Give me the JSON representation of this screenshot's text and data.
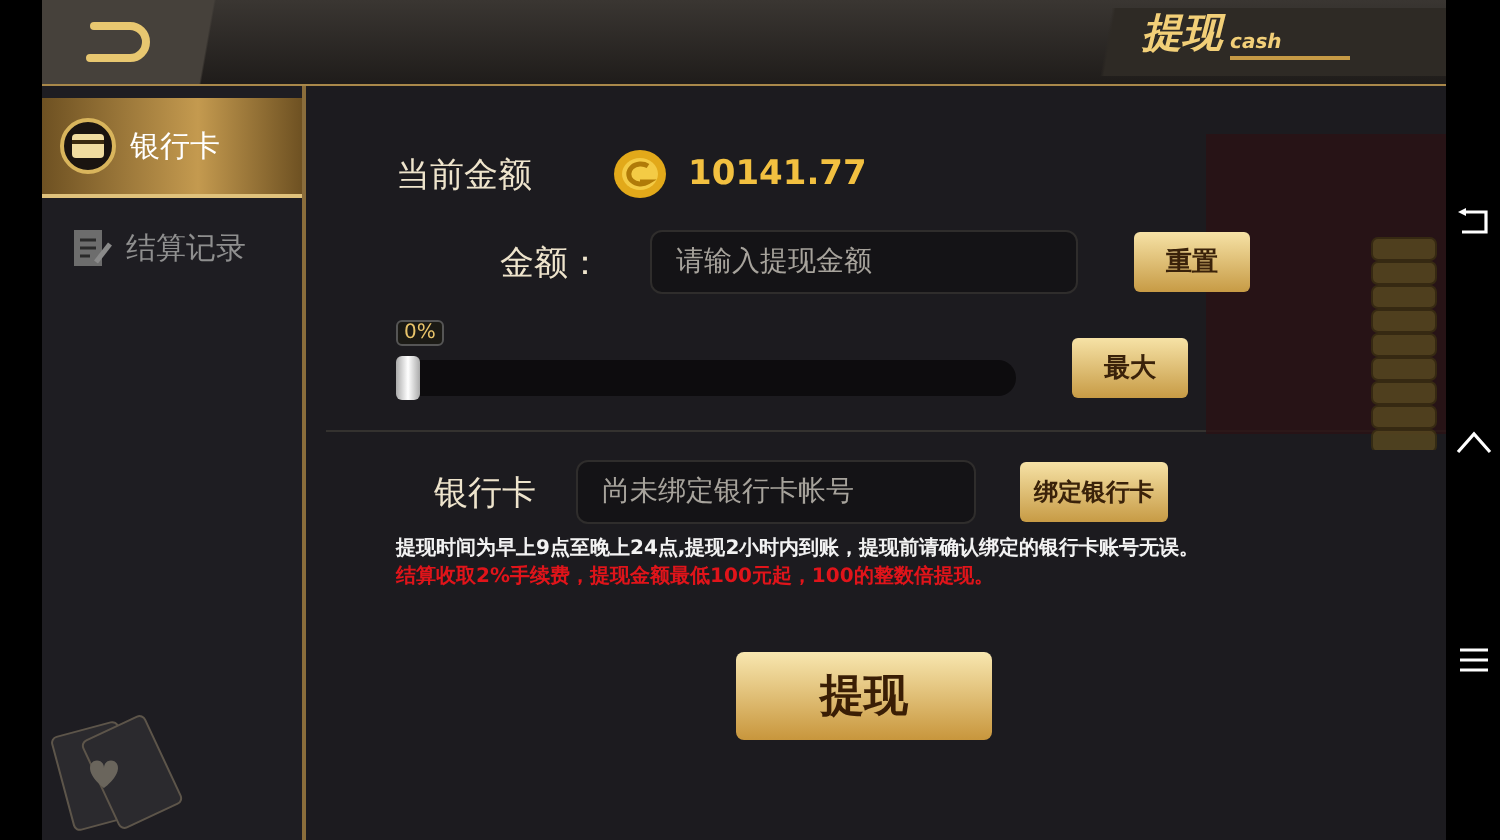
{
  "header": {
    "title": "提现",
    "subtitle": "cash"
  },
  "sidebar": {
    "items": [
      {
        "label": "银行卡",
        "selected": true
      },
      {
        "label": "结算记录",
        "selected": false
      }
    ]
  },
  "balance": {
    "label": "当前金额",
    "value": "10141.77"
  },
  "amount": {
    "label": "金额：",
    "placeholder": "请输入提现金额",
    "reset_button": "重置"
  },
  "slider": {
    "reading": "0%",
    "level": 0,
    "max_button": "最大"
  },
  "bank_card": {
    "label": "银行卡",
    "placeholder": "尚未绑定银行卡帐号",
    "bind_button": "绑定银行卡"
  },
  "notes": [
    {
      "kind": "info",
      "text": "提现时间为早上9点至晚上24点,提现2小时内到账，提现前请确认绑定的银行卡账号无误。"
    },
    {
      "kind": "warning",
      "text": "结算收取2%手续费，提现金额最低100元起，100的整数倍提现。"
    }
  ],
  "submit_button": "提现"
}
